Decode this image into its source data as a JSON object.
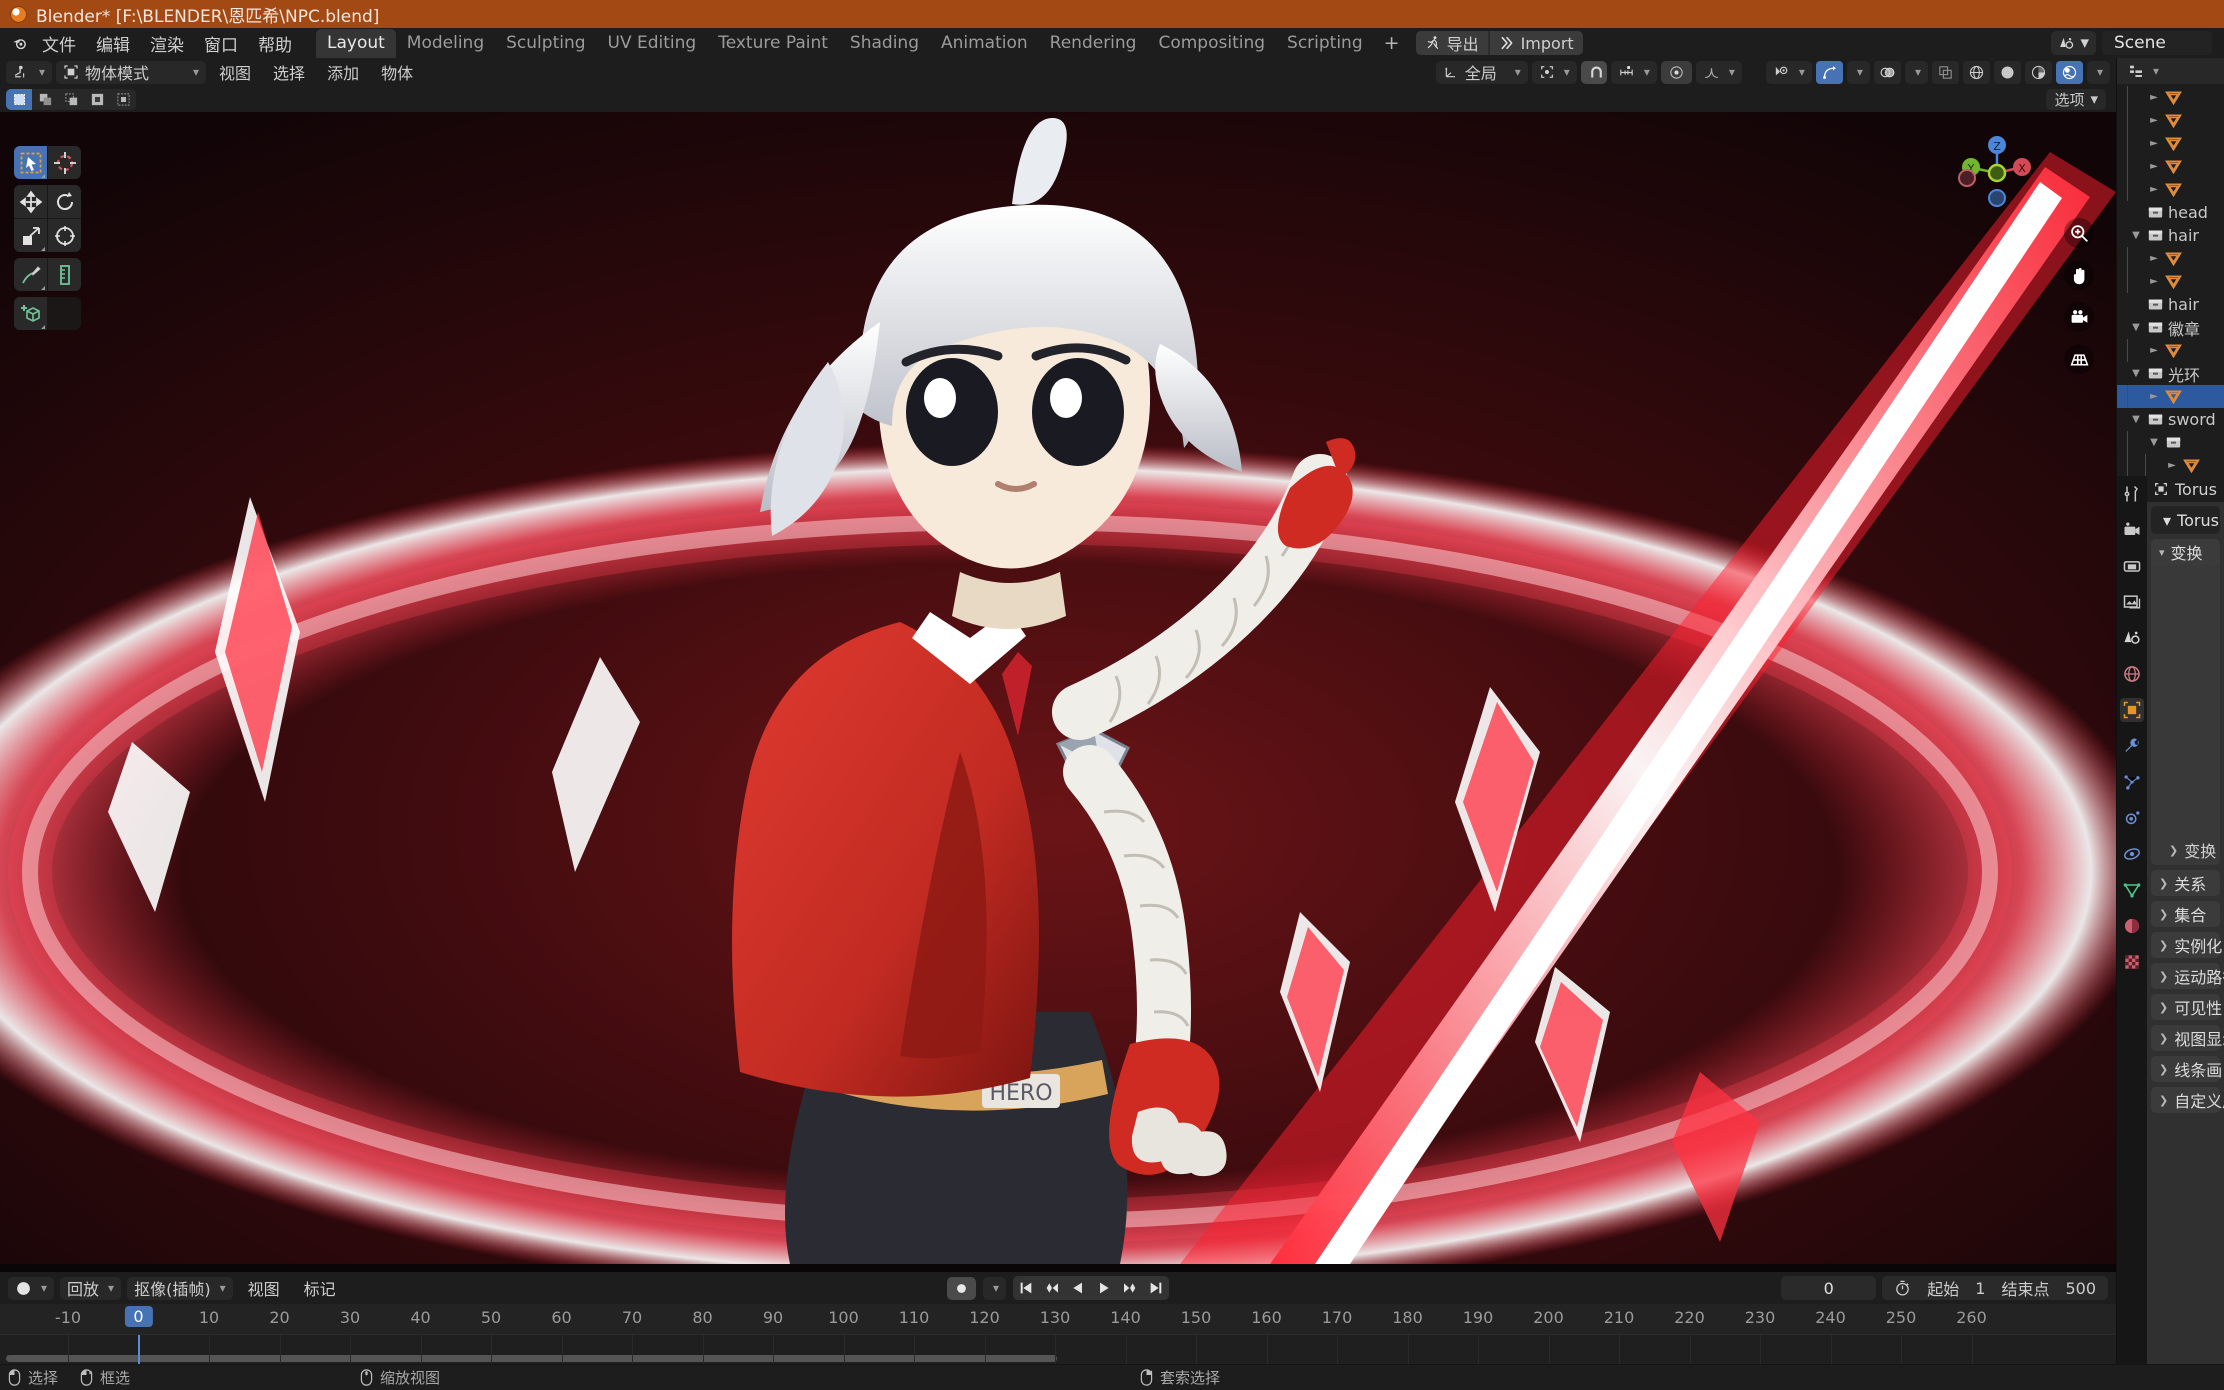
{
  "titlebar": {
    "icon": "blender-logo-icon",
    "text": "Blender* [F:\\BLENDER\\恩匹希\\NPC.blend]"
  },
  "topbar": {
    "menus": [
      "文件",
      "编辑",
      "渲染",
      "窗口",
      "帮助"
    ],
    "workspace_tabs": [
      {
        "label": "Layout",
        "active": true
      },
      {
        "label": "Modeling",
        "active": false
      },
      {
        "label": "Sculpting",
        "active": false
      },
      {
        "label": "UV Editing",
        "active": false
      },
      {
        "label": "Texture Paint",
        "active": false
      },
      {
        "label": "Shading",
        "active": false
      },
      {
        "label": "Animation",
        "active": false
      },
      {
        "label": "Rendering",
        "active": false
      },
      {
        "label": "Compositing",
        "active": false
      },
      {
        "label": "Scripting",
        "active": false
      }
    ],
    "add_workspace": "+",
    "addon_buttons": [
      {
        "label": "导出",
        "icon": "running-man-icon"
      },
      {
        "label": "Import",
        "icon": "double-chevron-icon"
      }
    ],
    "scene_label": "Scene"
  },
  "viewport_header": {
    "editor_type_icon": "editor-type-3dview-icon",
    "mode": "物体模式",
    "menus": [
      "视图",
      "选择",
      "添加",
      "物体"
    ],
    "transform_orientation": "全局",
    "pivot_icon": "pivot-point-icon",
    "snap_magnet_icon": "magnet-icon",
    "snap_icon": "snap-increment-icon",
    "proportional_icon": "proportional-edit-icon",
    "proportional_falloff_icon": "falloff-smooth-icon",
    "right_icons": [
      {
        "name": "visibility-selector-icon",
        "active": false
      },
      {
        "name": "gizmo-icon",
        "active": true
      },
      {
        "name": "overlays-icon",
        "active": false
      },
      {
        "name": "xray-toggle-icon",
        "active": false
      },
      {
        "name": "shading-wireframe-icon",
        "active": false
      },
      {
        "name": "shading-solid-icon",
        "active": false
      },
      {
        "name": "shading-material-icon",
        "active": false
      },
      {
        "name": "shading-rendered-icon",
        "active": true
      }
    ],
    "select_modes": [
      "set-new-icon",
      "extend-icon",
      "subtract-icon",
      "invert-icon",
      "intersect-icon"
    ],
    "options_label": "选项"
  },
  "tools": [
    {
      "name": "tweak-tool",
      "icon": "cursor-arrow-icon",
      "active": true
    },
    {
      "name": "cursor-tool",
      "icon": "3d-cursor-icon",
      "active": false
    },
    {
      "name": "move-tool",
      "icon": "move-arrows-icon",
      "active": false
    },
    {
      "name": "rotate-tool",
      "icon": "rotate-icon",
      "active": false
    },
    {
      "name": "scale-tool",
      "icon": "scale-icon",
      "active": false
    },
    {
      "name": "transform-tool",
      "icon": "transform-icon",
      "active": false
    },
    {
      "name": "annotate-tool",
      "icon": "pencil-icon",
      "active": false
    },
    {
      "name": "measure-tool",
      "icon": "ruler-icon",
      "active": false
    },
    {
      "name": "add-cube-tool",
      "icon": "add-cube-icon",
      "active": false
    }
  ],
  "gizmo": {
    "axes": [
      "Z",
      "Y",
      "X"
    ],
    "nav_buttons": [
      "zoom-icon",
      "pan-hand-icon",
      "camera-icon",
      "grid-ortho-icon"
    ]
  },
  "outliner": {
    "header_icons": [
      "editor-type-outliner-icon",
      "display-mode-icon",
      "filter-icon",
      "search-icon"
    ],
    "rows": [
      {
        "label": "",
        "type": "mesh",
        "depth": 3,
        "expandable": true,
        "selected": false
      },
      {
        "label": "",
        "type": "mesh",
        "depth": 3,
        "expandable": true,
        "selected": false
      },
      {
        "label": "",
        "type": "mesh",
        "depth": 3,
        "expandable": true,
        "selected": false
      },
      {
        "label": "",
        "type": "mesh",
        "depth": 3,
        "expandable": true,
        "selected": false
      },
      {
        "label": "",
        "type": "mesh",
        "depth": 3,
        "expandable": true,
        "selected": false
      },
      {
        "label": "head",
        "type": "collection",
        "depth": 2,
        "expandable": false,
        "selected": false
      },
      {
        "label": "hair",
        "type": "collection",
        "depth": 2,
        "expandable": true,
        "expanded": true,
        "selected": false
      },
      {
        "label": "",
        "type": "mesh",
        "depth": 3,
        "expandable": true,
        "selected": false
      },
      {
        "label": "",
        "type": "mesh",
        "depth": 3,
        "expandable": true,
        "selected": false
      },
      {
        "label": "hair",
        "type": "collection",
        "depth": 2,
        "expandable": false,
        "selected": false
      },
      {
        "label": "徽章",
        "type": "collection",
        "depth": 2,
        "expandable": true,
        "expanded": true,
        "selected": false
      },
      {
        "label": "",
        "type": "mesh",
        "depth": 3,
        "expandable": true,
        "selected": false
      },
      {
        "label": "光环",
        "type": "collection",
        "depth": 2,
        "expandable": true,
        "expanded": true,
        "selected": false
      },
      {
        "label": "",
        "type": "mesh",
        "depth": 3,
        "expandable": true,
        "selected": true
      },
      {
        "label": "sword",
        "type": "collection",
        "depth": 2,
        "expandable": true,
        "expanded": true,
        "selected": false
      },
      {
        "label": "",
        "type": "collection",
        "depth": 3,
        "expandable": true,
        "expanded": true,
        "selected": false
      },
      {
        "label": "",
        "type": "mesh",
        "depth": 4,
        "expandable": true,
        "selected": false
      },
      {
        "label": "",
        "type": "mesh",
        "depth": 3,
        "expandable": true,
        "selected": false
      },
      {
        "label": "",
        "type": "mesh",
        "depth": 3,
        "expandable": true,
        "selected": false
      },
      {
        "label": "",
        "type": "mesh",
        "depth": 3,
        "expandable": true,
        "selected": false
      }
    ]
  },
  "properties": {
    "tabs": [
      {
        "name": "tool-tab",
        "icon": "tool-wrench-icon",
        "active": false
      },
      {
        "name": "render-tab",
        "icon": "render-camera-icon",
        "active": false
      },
      {
        "name": "output-tab",
        "icon": "printer-icon",
        "active": false
      },
      {
        "name": "viewlayer-tab",
        "icon": "images-icon",
        "active": false
      },
      {
        "name": "scene-tab",
        "icon": "scene-cone-icon",
        "active": false
      },
      {
        "name": "world-tab",
        "icon": "world-globe-icon",
        "active": false
      },
      {
        "name": "object-tab",
        "icon": "object-square-icon",
        "active": true
      },
      {
        "name": "modifier-tab",
        "icon": "wrench-icon",
        "active": false
      },
      {
        "name": "particles-tab",
        "icon": "particles-icon",
        "active": false
      },
      {
        "name": "physics-tab",
        "icon": "physics-orbit-icon",
        "active": false
      },
      {
        "name": "constraints-tab",
        "icon": "constraint-icon",
        "active": false
      },
      {
        "name": "data-tab",
        "icon": "mesh-data-triangle-icon",
        "active": false
      },
      {
        "name": "material-tab",
        "icon": "material-sphere-icon",
        "active": false
      },
      {
        "name": "texture-tab",
        "icon": "texture-checker-icon",
        "active": false
      }
    ],
    "breadcrumb_object": "Torus",
    "idblock_name": "Torus",
    "panels": [
      {
        "label": "变换",
        "open": true
      },
      {
        "label": "变换",
        "open": false,
        "sub": true
      },
      {
        "label": "关系",
        "open": false
      },
      {
        "label": "集合",
        "open": false
      },
      {
        "label": "实例化",
        "open": false
      },
      {
        "label": "运动路径",
        "open": false
      },
      {
        "label": "可见性",
        "open": false
      },
      {
        "label": "视图显示",
        "open": false
      },
      {
        "label": "线条画",
        "open": false
      },
      {
        "label": "自定义属性",
        "open": false
      }
    ]
  },
  "timeline": {
    "editor_icon": "editor-type-timeline-icon",
    "playback_label": "回放",
    "keying_label": "抠像(插帧)",
    "menus": [
      "视图",
      "标记"
    ],
    "record_icon": "record-icon",
    "playback_buttons": [
      "jump-to-start-icon",
      "prev-keyframe-icon",
      "play-reverse-icon",
      "play-icon",
      "next-keyframe-icon",
      "jump-to-end-icon"
    ],
    "current_frame": "0",
    "timer_icon": "stopwatch-icon",
    "start_label": "起始",
    "start_value": "1",
    "end_label": "结束点",
    "end_value": "500",
    "ruler_ticks": [
      "-10",
      "0",
      "10",
      "20",
      "30",
      "40",
      "50",
      "60",
      "70",
      "80",
      "90",
      "100",
      "110",
      "120",
      "130",
      "140",
      "150",
      "160",
      "170",
      "180",
      "190",
      "200",
      "210",
      "220",
      "230",
      "240",
      "250",
      "260"
    ],
    "playhead_frame": "0"
  },
  "statusbar": {
    "items": [
      {
        "icon": "mouse-left-icon",
        "label": "选择"
      },
      {
        "icon": "mouse-left-drag-icon",
        "label": "框选"
      },
      {
        "icon": "mouse-middle-icon",
        "label": "缩放视图"
      },
      {
        "icon": "mouse-right-icon",
        "label": "套索选择"
      }
    ]
  },
  "colors": {
    "accent_blue": "#4772b3",
    "title_orange": "#a34a14",
    "outliner_mesh": "#e08a3c",
    "selection_blue": "#2d5a9e"
  }
}
